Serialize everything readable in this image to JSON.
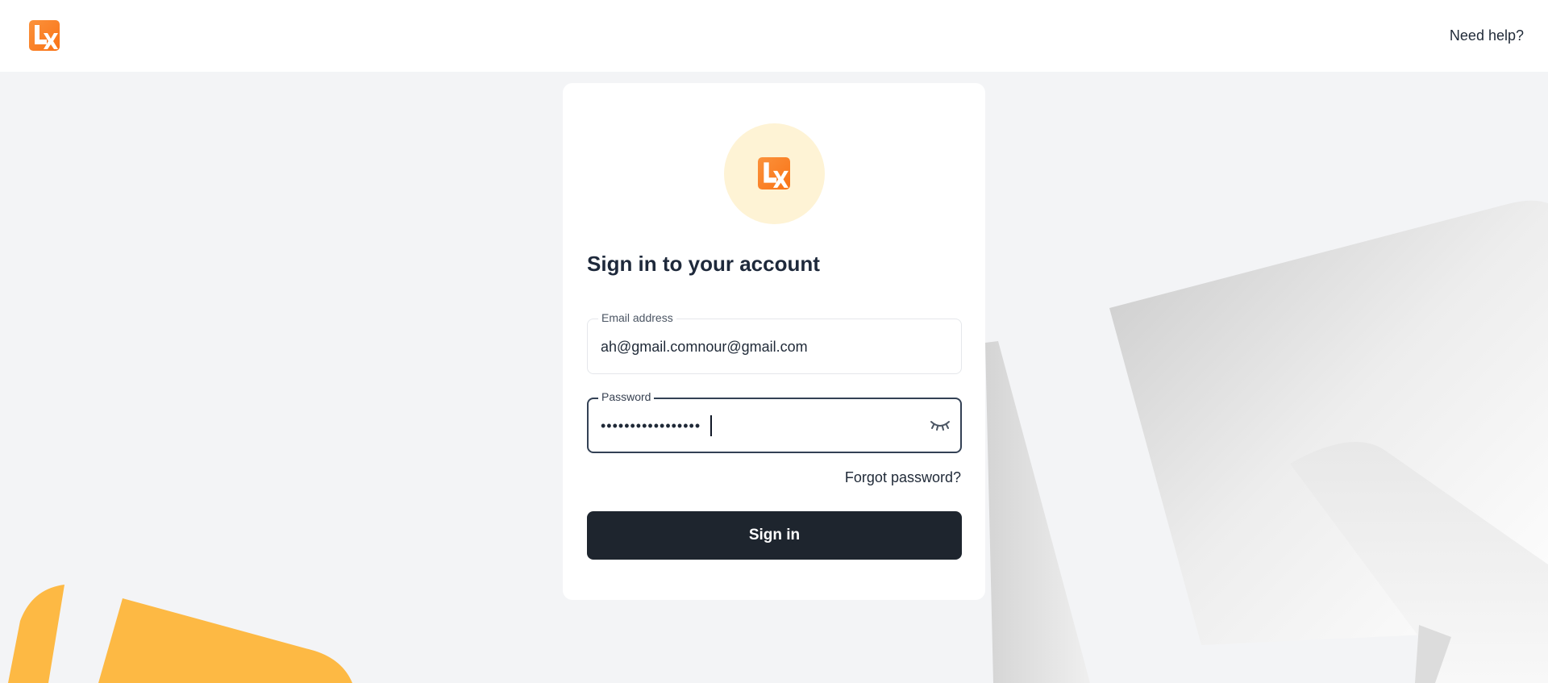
{
  "header": {
    "logo_icon": "lx-logo-icon",
    "help_label": "Need help?"
  },
  "card": {
    "logo_icon": "lx-logo-icon",
    "title": "Sign in to your account",
    "email": {
      "label": "Email address",
      "value": "ah@gmail.comnour@gmail.com"
    },
    "password": {
      "label": "Password",
      "value": "•••••••••••••••••",
      "toggle_icon": "eye-closed-icon"
    },
    "forgot_label": "Forgot password?",
    "submit_label": "Sign in"
  },
  "colors": {
    "brand_orange": "#f97316",
    "brand_yellow": "#fdb944",
    "button_dark": "#1e252e",
    "background": "#f3f4f6"
  }
}
